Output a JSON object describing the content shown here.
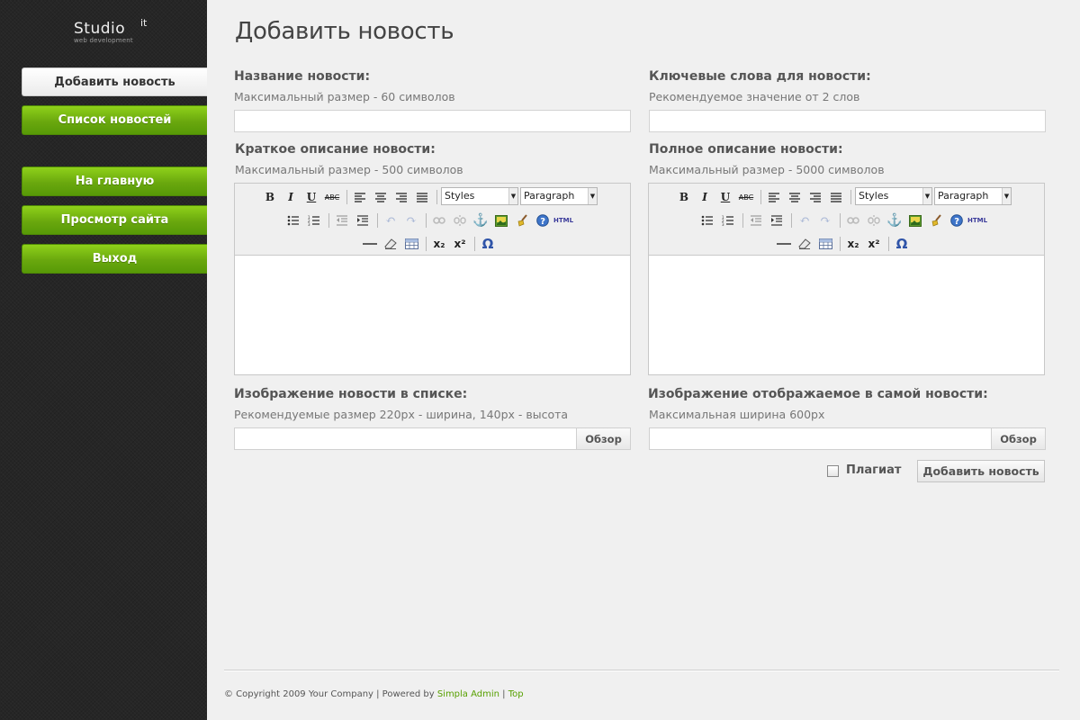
{
  "logo": {
    "main": "Studio",
    "sup": "it",
    "sub": "web development"
  },
  "nav": {
    "items": [
      {
        "label": "Добавить новость"
      },
      {
        "label": "Список новостей"
      },
      {
        "label": "На главную"
      },
      {
        "label": "Просмотр сайта"
      },
      {
        "label": "Выход"
      }
    ]
  },
  "page": {
    "title": "Добавить новость"
  },
  "form": {
    "title_field": {
      "label": "Название новости:",
      "hint": "Максимальный размер - 60 символов",
      "value": ""
    },
    "keywords_field": {
      "label": "Ключевые слова для новости:",
      "hint": "Рекомендуемое значение от 2 слов",
      "value": ""
    },
    "short_desc": {
      "label": "Краткое описание новости:",
      "hint": "Максимальный размер - 500 символов"
    },
    "full_desc": {
      "label": "Полное описание новости:",
      "hint": "Максимальный размер - 5000 символов"
    },
    "image_list": {
      "label": "Изображение новости в списке:",
      "hint": "Рекомендуемые размер 220px - ширина, 140px - высота",
      "button": "Обзор"
    },
    "image_full": {
      "label": "Изображение отображаемое в самой новости:",
      "hint": "Максимальная ширина 600px",
      "button": "Обзор"
    },
    "plagiat_label": "Плагиат",
    "plagiat_checked": false,
    "submit_label": "Добавить новость"
  },
  "editor": {
    "styles_select": "Styles",
    "format_select": "Paragraph",
    "buttons": {
      "bold": "B",
      "italic": "I",
      "underline": "U",
      "strike": "ABC",
      "html": "HTML",
      "sub": "x₂",
      "sup": "x²",
      "charmap": "Ω"
    }
  },
  "footer": {
    "copyright": "© Copyright 2009 Your Company | Powered by ",
    "powered_link": "Simpla Admin",
    "separator": " | ",
    "top_link": "Top"
  },
  "colors": {
    "accent_green": "#6aa80e",
    "link_green": "#57a000",
    "sidebar": "#262626"
  }
}
